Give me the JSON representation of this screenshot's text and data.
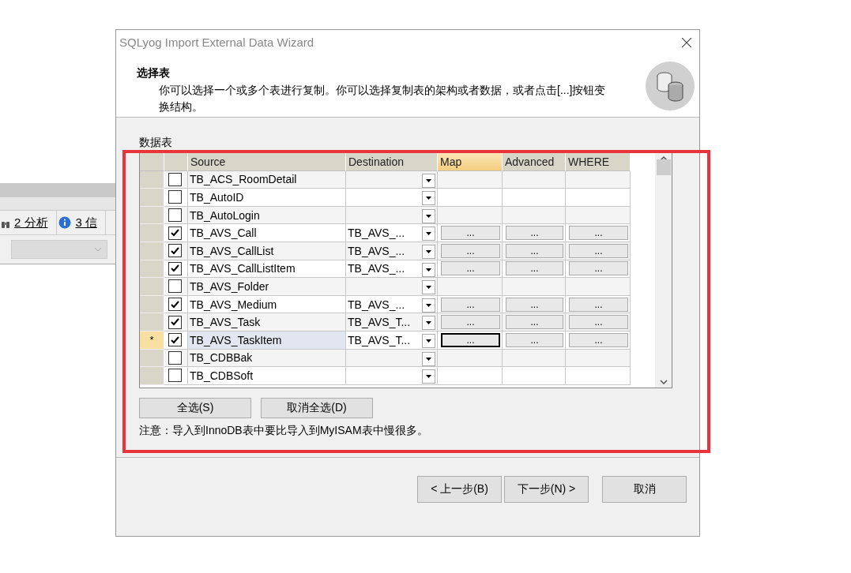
{
  "background_app": {
    "tabs": [
      {
        "label": "2 分析"
      },
      {
        "label": "3 信"
      }
    ]
  },
  "window": {
    "title": "SQLyog Import External Data Wizard"
  },
  "header": {
    "title": "选择表",
    "description": "你可以选择一个或多个表进行复制。你可以选择复制表的架构或者数据，或者点击[...]按钮变换结构。"
  },
  "section_label": "数据表",
  "table": {
    "columns": [
      {
        "label": "Source",
        "selected": false
      },
      {
        "label": "Destination",
        "selected": false
      },
      {
        "label": "Map",
        "selected": true
      },
      {
        "label": "Advanced",
        "selected": false
      },
      {
        "label": "WHERE",
        "selected": false
      }
    ],
    "rows": [
      {
        "marker": "",
        "checked": false,
        "selected": false,
        "source": "TB_ACS_RoomDetail",
        "destination": "",
        "buttons": []
      },
      {
        "marker": "",
        "checked": false,
        "selected": false,
        "source": "TB_AutoID",
        "destination": "",
        "buttons": []
      },
      {
        "marker": "",
        "checked": false,
        "selected": false,
        "source": "TB_AutoLogin",
        "destination": "",
        "buttons": []
      },
      {
        "marker": "",
        "checked": true,
        "selected": false,
        "source": "TB_AVS_Call",
        "destination": "TB_AVS_...",
        "buttons": [
          "...",
          "...",
          "..."
        ]
      },
      {
        "marker": "",
        "checked": true,
        "selected": false,
        "source": "TB_AVS_CallList",
        "destination": "TB_AVS_...",
        "buttons": [
          "...",
          "...",
          "..."
        ]
      },
      {
        "marker": "",
        "checked": true,
        "selected": false,
        "source": "TB_AVS_CallListItem",
        "destination": "TB_AVS_...",
        "buttons": [
          "...",
          "...",
          "..."
        ]
      },
      {
        "marker": "",
        "checked": false,
        "selected": false,
        "source": "TB_AVS_Folder",
        "destination": "",
        "buttons": []
      },
      {
        "marker": "",
        "checked": true,
        "selected": false,
        "source": "TB_AVS_Medium",
        "destination": "TB_AVS_...",
        "buttons": [
          "...",
          "...",
          "..."
        ]
      },
      {
        "marker": "",
        "checked": true,
        "selected": false,
        "source": "TB_AVS_Task",
        "destination": "TB_AVS_T...",
        "buttons": [
          "...",
          "...",
          "..."
        ]
      },
      {
        "marker": "*",
        "checked": true,
        "selected": true,
        "source": "TB_AVS_TaskItem",
        "destination": "TB_AVS_T...",
        "buttons": [
          "...",
          "...",
          "..."
        ]
      },
      {
        "marker": "",
        "checked": false,
        "selected": false,
        "source": "TB_CDBBak",
        "destination": "",
        "buttons": []
      },
      {
        "marker": "",
        "checked": false,
        "selected": false,
        "source": "TB_CDBSoft",
        "destination": "",
        "buttons": []
      }
    ]
  },
  "select_buttons": [
    "全选(S)",
    "取消全选(D)"
  ],
  "note": "注意：导入到InnoDB表中要比导入到MyISAM表中慢很多。",
  "footer_buttons": [
    "< 上一步(B)",
    "下一步(N) >",
    "取消"
  ]
}
